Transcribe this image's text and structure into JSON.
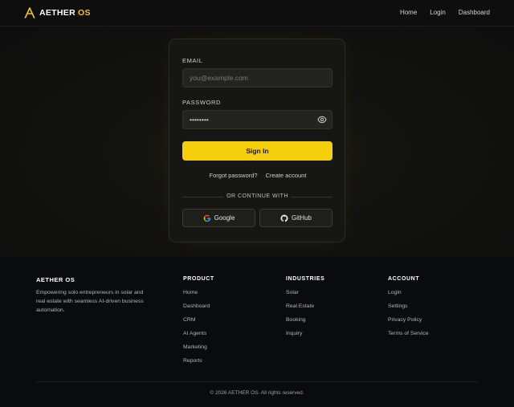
{
  "header": {
    "brand_main": "AETHER",
    "brand_accent": "OS",
    "nav": [
      "Home",
      "Login",
      "Dashboard"
    ]
  },
  "login": {
    "email_label": "EMAIL",
    "email_placeholder": "you@example.com",
    "password_label": "PASSWORD",
    "password_value": "••••••••",
    "signin_label": "Sign In",
    "forgot_label": "Forgot password?",
    "create_label": "Create account",
    "divider_label": "OR CONTINUE WITH",
    "google_label": "Google",
    "github_label": "GitHub"
  },
  "footer": {
    "brand": "AETHER OS",
    "description": "Empowering solo entrepreneurs in solar and real estate with seamless AI-driven business automation.",
    "columns": [
      {
        "title": "PRODUCT",
        "links": [
          "Home",
          "Dashboard",
          "CRM",
          "AI Agents",
          "Marketing",
          "Reports"
        ]
      },
      {
        "title": "INDUSTRIES",
        "links": [
          "Solar",
          "Real Estate",
          "Booking",
          "Inquiry"
        ]
      },
      {
        "title": "ACCOUNT",
        "links": [
          "Login",
          "Settings",
          "Privacy Policy",
          "Terms of Service"
        ]
      }
    ],
    "copyright": "© 2026 AETHER OS. All rights reserved."
  },
  "colors": {
    "accent": "#f5c518",
    "button": "#f5cf0b",
    "background": "#0d0d0e"
  }
}
